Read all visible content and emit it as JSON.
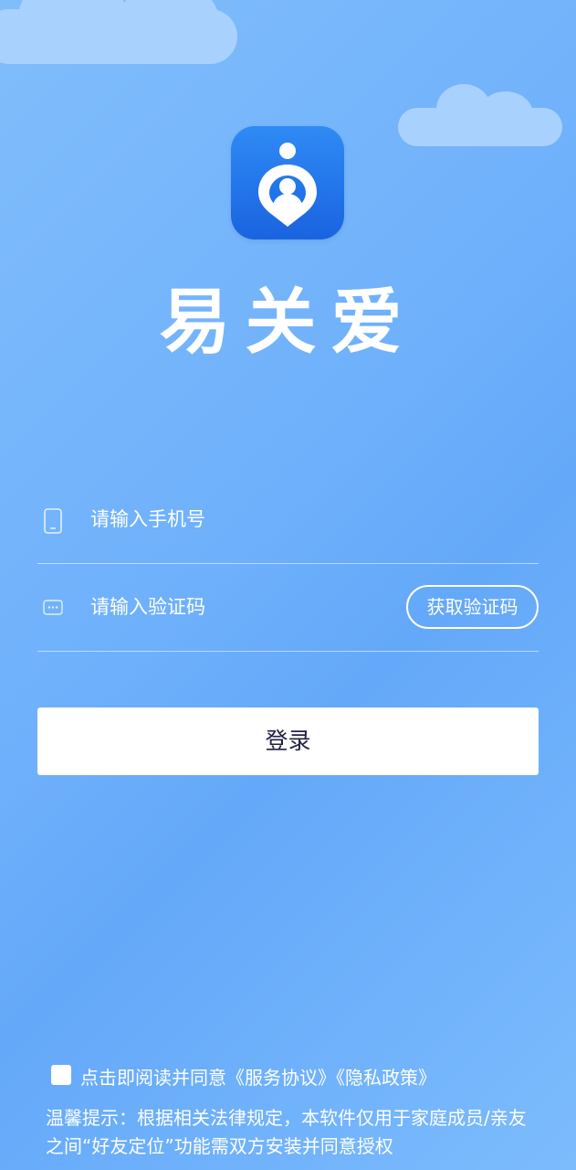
{
  "app": {
    "name": "易关爱",
    "icon": "location-person-logo-icon",
    "icon_gradient": [
      "#2f8bf5",
      "#1a63e0"
    ]
  },
  "background": {
    "gradient": [
      "#80bdfb",
      "#64a8f9",
      "#7cbcfd"
    ],
    "cloud_color": "#a9d1fd"
  },
  "login_form": {
    "phone": {
      "icon": "phone-icon",
      "placeholder": "请输入手机号",
      "value": ""
    },
    "code": {
      "icon": "message-code-icon",
      "placeholder": "请输入验证码",
      "value": "",
      "get_code_label": "获取验证码"
    },
    "submit_label": "登录"
  },
  "agreement": {
    "checked": false,
    "text": "点击即阅读并同意《服务协议》《隐私政策》"
  },
  "notice": {
    "text": "温馨提示：根据相关法律规定，本软件仅用于家庭成员/亲友之间“好友定位”功能需双方安装并同意授权"
  }
}
